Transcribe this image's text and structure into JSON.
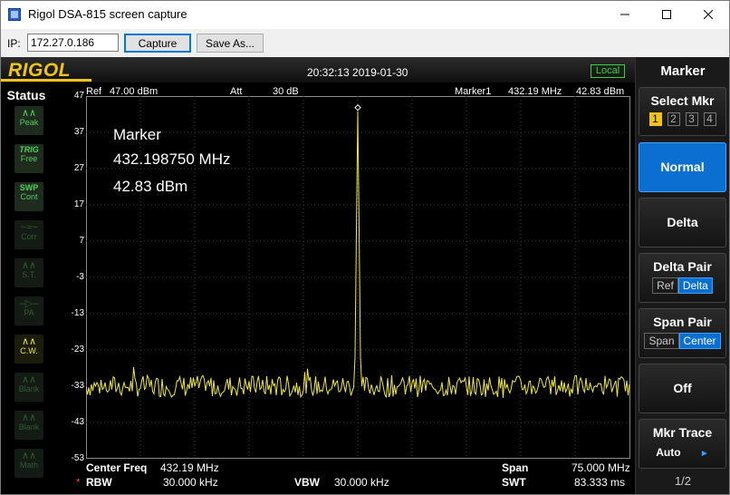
{
  "window": {
    "title": "Rigol DSA-815 screen capture"
  },
  "toolbar": {
    "ip_label": "IP:",
    "ip_value": "172.27.0.186",
    "capture_label": "Capture",
    "saveas_label": "Save As..."
  },
  "header": {
    "logo": "RIGOL",
    "datetime": "20:32:13 2019-01-30",
    "local": "Local"
  },
  "status": {
    "title": "Status",
    "items": [
      {
        "name": "Peak",
        "state": "on"
      },
      {
        "name": "TRIG Free",
        "top": "TRIG",
        "bottom": "Free",
        "state": "on"
      },
      {
        "name": "SWP Cont",
        "top": "SWP",
        "bottom": "Cont",
        "state": "on"
      },
      {
        "name": "Corr",
        "state": "off"
      },
      {
        "name": "S.T.",
        "state": "off"
      },
      {
        "name": "PA",
        "state": "off"
      },
      {
        "name": "C.W.",
        "state": "cw"
      },
      {
        "name": "Blank",
        "state": "off"
      },
      {
        "name": "Blank",
        "state": "off"
      },
      {
        "name": "Math",
        "state": "off"
      }
    ]
  },
  "plot": {
    "ref_label": "Ref",
    "ref_value": "47.00 dBm",
    "att_label": "Att",
    "att_value": "30 dB",
    "marker1_label": "Marker1",
    "marker1_freq": "432.19 MHz",
    "marker1_amp": "42.83 dBm",
    "y_ticks": [
      "47",
      "37",
      "27",
      "17",
      "7",
      "-3",
      "-13",
      "-23",
      "-33",
      "-43",
      "-53"
    ],
    "marker_title": "Marker",
    "marker_freq": "432.198750 MHz",
    "marker_amp": "42.83 dBm",
    "center_label": "Center Freq",
    "center_value": "432.19 MHz",
    "span_label": "Span",
    "span_value": "75.000 MHz",
    "rbw_star": "*",
    "rbw_label": "RBW",
    "rbw_value": "30.000 kHz",
    "vbw_label": "VBW",
    "vbw_value": "30.000 kHz",
    "swt_label": "SWT",
    "swt_value": "83.333 ms"
  },
  "softkeys": {
    "title": "Marker",
    "select_label": "Select Mkr",
    "marker_numbers": [
      "1",
      "2",
      "3",
      "4"
    ],
    "normal": "Normal",
    "delta": "Delta",
    "delta_pair": "Delta Pair",
    "delta_pair_ref": "Ref",
    "delta_pair_delta": "Delta",
    "span_pair": "Span Pair",
    "span_pair_span": "Span",
    "span_pair_center": "Center",
    "off": "Off",
    "mkr_trace": "Mkr Trace",
    "mkr_trace_value": "Auto",
    "page": "1/2"
  },
  "colors": {
    "trace": "#f0e83a",
    "logo": "#f0c418",
    "active_key": "#0a6fd0",
    "local": "#35d23a"
  },
  "chart_data": {
    "type": "line",
    "title": "",
    "xlabel": "",
    "ylabel": "",
    "ylim": [
      -53,
      47
    ],
    "center_freq_mhz": 432.19,
    "span_mhz": 75.0,
    "noise_floor_dbm": -33,
    "peak": {
      "freq_mhz": 432.19875,
      "amp_dbm": 42.83
    }
  }
}
